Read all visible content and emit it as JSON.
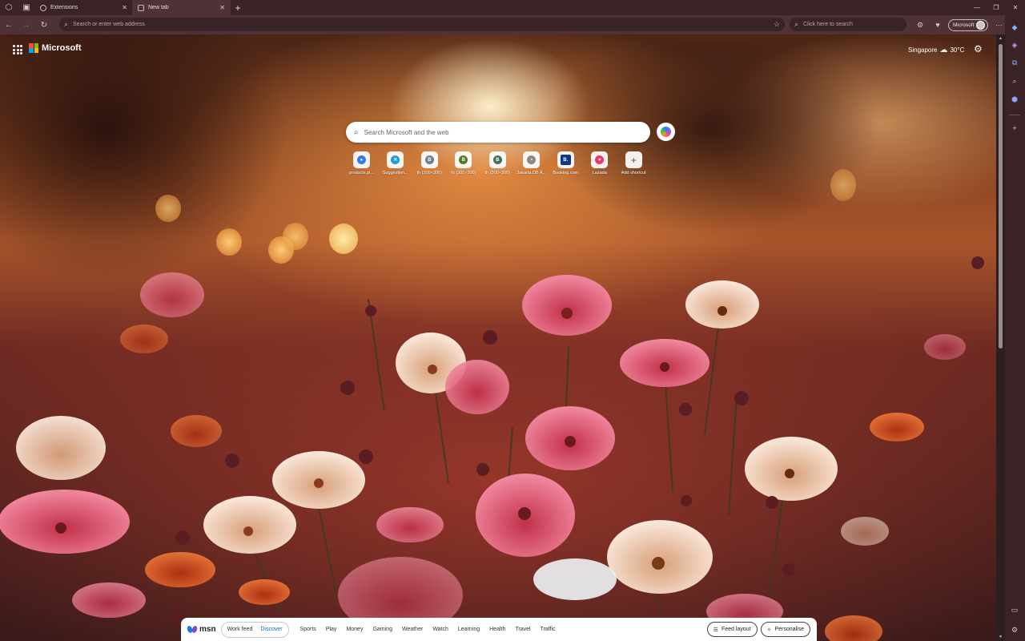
{
  "tabs": [
    {
      "label": "Extensions",
      "icon": "gear-icon",
      "active": false
    },
    {
      "label": "New tab",
      "icon": "page-icon",
      "active": true
    }
  ],
  "address_bar": {
    "placeholder": "Search or enter web address"
  },
  "toolbar_search": {
    "placeholder": "Click here to search"
  },
  "profile": {
    "label": "Microsoft"
  },
  "page": {
    "brand": "Microsoft",
    "weather": {
      "location": "Singapore",
      "temperature": "30°C"
    },
    "search_placeholder": "Search Microsoft and the web",
    "quick_links": [
      {
        "label": "products.pl...",
        "icon_text": "",
        "color": "#2f7bf5"
      },
      {
        "label": "Suggestion...",
        "icon_text": "",
        "color": "#1aa0d8"
      },
      {
        "label": "th (300×300)",
        "icon_text": "B",
        "color": "#6b7f95"
      },
      {
        "label": "th (300×300)",
        "icon_text": "B",
        "color": "#4f7a2a"
      },
      {
        "label": "th (300×300)",
        "icon_text": "B",
        "color": "#3f7060"
      },
      {
        "label": "Jakarta.DB A...",
        "icon_text": "",
        "color": "#8a8a8a"
      },
      {
        "label": "Booking.com",
        "icon_text": "B.",
        "color": "#0a3a8a"
      },
      {
        "label": "Lazada",
        "icon_text": "",
        "color": "#e9366b"
      },
      {
        "label": "Add shortcut",
        "icon_text": "+",
        "color": "#555555"
      }
    ]
  },
  "msn_bar": {
    "logo": "msn",
    "feed_tabs": [
      {
        "label": "Work feed",
        "active": false
      },
      {
        "label": "Discover",
        "active": true
      }
    ],
    "nav": [
      "Sports",
      "Play",
      "Money",
      "Gaming",
      "Weather",
      "Watch",
      "Learning",
      "Health",
      "Travel",
      "Traffic"
    ],
    "feed_layout": "Feed layout",
    "personalise": "Personalise"
  }
}
